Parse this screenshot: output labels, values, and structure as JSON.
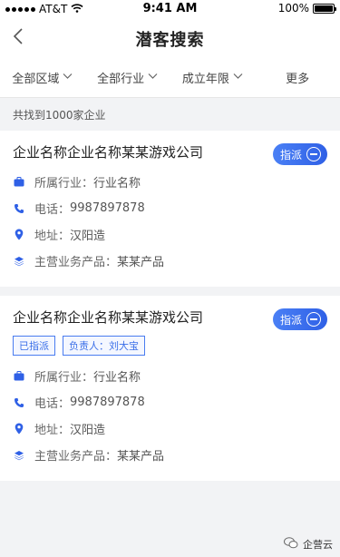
{
  "status_bar": {
    "carrier": "AT&T",
    "time": "9:41 AM",
    "battery": "100%",
    "battery_level": 1.0
  },
  "nav": {
    "title": "潜客搜索",
    "back_icon": "chevron-left-icon"
  },
  "filters": [
    {
      "label": "全部区域",
      "icon": "chevron-down-icon"
    },
    {
      "label": "全部行业",
      "icon": "chevron-down-icon"
    },
    {
      "label": "成立年限",
      "icon": "chevron-down-icon"
    },
    {
      "label": "更多",
      "icon": ""
    }
  ],
  "result_count": "共找到1000家企业",
  "cards": [
    {
      "name": "企业名称企业名称某某游戏公司",
      "assign_label": "指派",
      "tags": [],
      "rows": [
        {
          "icon": "briefcase-icon",
          "label": "所属行业：",
          "value": "行业名称"
        },
        {
          "icon": "phone-icon",
          "label": "电话：",
          "value": "9987897878"
        },
        {
          "icon": "location-pin-icon",
          "label": "地址：",
          "value": "汉阳造"
        },
        {
          "icon": "layers-icon",
          "label": "主营业务产品：",
          "value": "某某产品"
        }
      ]
    },
    {
      "name": "企业名称企业名称某某游戏公司",
      "assign_label": "指派",
      "tags": [
        "已指派",
        "负责人：刘大宝"
      ],
      "rows": [
        {
          "icon": "briefcase-icon",
          "label": "所属行业：",
          "value": "行业名称"
        },
        {
          "icon": "phone-icon",
          "label": "电话：",
          "value": "9987897878"
        },
        {
          "icon": "location-pin-icon",
          "label": "地址：",
          "value": "汉阳造"
        },
        {
          "icon": "layers-icon",
          "label": "主营业务产品：",
          "value": "某某产品"
        }
      ]
    }
  ],
  "watermark": "企营云",
  "colors": {
    "accent": "#3b6fe8",
    "icon": "#2f60e6"
  }
}
